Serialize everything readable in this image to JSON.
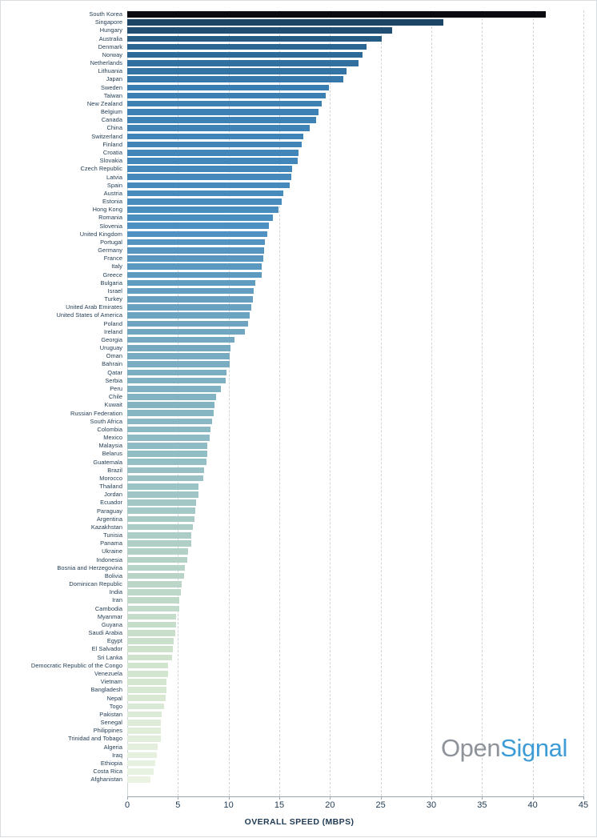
{
  "axis": {
    "title": "OVERALL SPEED (MBPS)",
    "ticks": [
      "0",
      "5",
      "10",
      "15",
      "20",
      "25",
      "30",
      "35",
      "40",
      "45"
    ]
  },
  "logo": {
    "open": "Open",
    "signal": "Signal"
  },
  "colors": {
    "highlight": "#0a0a10",
    "top": "#1c4464",
    "mid_blue": "#4a8ec0",
    "mid_teal": "#8fbcc4",
    "low_green": "#cfe3cc",
    "bottom": "#eaf3e2",
    "gridline": "#cfd6da",
    "text": "#1f3a52",
    "logo_open": "#8d9399",
    "logo_signal": "#3d9bd6"
  },
  "chart_data": {
    "type": "bar",
    "orientation": "horizontal",
    "title": "",
    "xlabel": "OVERALL SPEED (MBPS)",
    "ylabel": "",
    "xlim": [
      0,
      45
    ],
    "grid": true,
    "legend": false,
    "highlight_category": "South Korea",
    "categories": [
      "South Korea",
      "Singapore",
      "Hungary",
      "Australia",
      "Denmark",
      "Norway",
      "Netherlands",
      "Lithuania",
      "Japan",
      "Sweden",
      "Taiwan",
      "New Zealand",
      "Belgium",
      "Canada",
      "China",
      "Switzerland",
      "Finland",
      "Croatia",
      "Slovakia",
      "Czech Republic",
      "Latvia",
      "Spain",
      "Austria",
      "Estonia",
      "Hong Kong",
      "Romania",
      "Slovenia",
      "United Kingdom",
      "Portugal",
      "Germany",
      "France",
      "Italy",
      "Greece",
      "Bulgaria",
      "Israel",
      "Turkey",
      "United Arab Emirates",
      "United States of America",
      "Poland",
      "Ireland",
      "Georgia",
      "Uruguay",
      "Oman",
      "Bahrain",
      "Qatar",
      "Serbia",
      "Peru",
      "Chile",
      "Kuwait",
      "Russian Federation",
      "South Africa",
      "Colombia",
      "Mexico",
      "Malaysia",
      "Belarus",
      "Guatemala",
      "Brazil",
      "Morocco",
      "Thailand",
      "Jordan",
      "Ecuador",
      "Paraguay",
      "Argentina",
      "Kazakhstan",
      "Tunisia",
      "Panama",
      "Ukraine",
      "Indonesia",
      "Bosnia and Herzegovina",
      "Bolivia",
      "Dominican Republic",
      "India",
      "Iran",
      "Cambodia",
      "Myanmar",
      "Guyana",
      "Saudi Arabia",
      "Egypt",
      "El Salvador",
      "Sri Lanka",
      "Democratic Republic of the Congo",
      "Venezuela",
      "Vietnam",
      "Bangladesh",
      "Nepal",
      "Togo",
      "Pakistan",
      "Senegal",
      "Philippines",
      "Trinidad and Tobago",
      "Algeria",
      "Iraq",
      "Ethiopia",
      "Costa Rica",
      "Afghanistan"
    ],
    "values": [
      41.3,
      31.2,
      26.1,
      25.1,
      23.6,
      23.2,
      22.8,
      21.6,
      21.3,
      19.9,
      19.6,
      19.2,
      18.9,
      18.6,
      18.0,
      17.4,
      17.2,
      16.9,
      16.8,
      16.3,
      16.2,
      16.0,
      15.4,
      15.2,
      14.9,
      14.4,
      14.0,
      13.8,
      13.6,
      13.5,
      13.4,
      13.3,
      13.3,
      12.6,
      12.5,
      12.4,
      12.2,
      12.1,
      11.9,
      11.6,
      10.6,
      10.2,
      10.1,
      10.1,
      9.8,
      9.7,
      9.2,
      8.8,
      8.6,
      8.5,
      8.4,
      8.2,
      8.1,
      7.9,
      7.9,
      7.8,
      7.6,
      7.5,
      7.0,
      7.0,
      6.8,
      6.7,
      6.6,
      6.5,
      6.3,
      6.3,
      6.0,
      5.9,
      5.7,
      5.6,
      5.4,
      5.3,
      5.1,
      5.1,
      4.8,
      4.8,
      4.7,
      4.6,
      4.5,
      4.4,
      4.0,
      4.0,
      3.9,
      3.9,
      3.8,
      3.6,
      3.4,
      3.3,
      3.3,
      3.3,
      3.0,
      2.9,
      2.8,
      2.6,
      2.3
    ]
  }
}
